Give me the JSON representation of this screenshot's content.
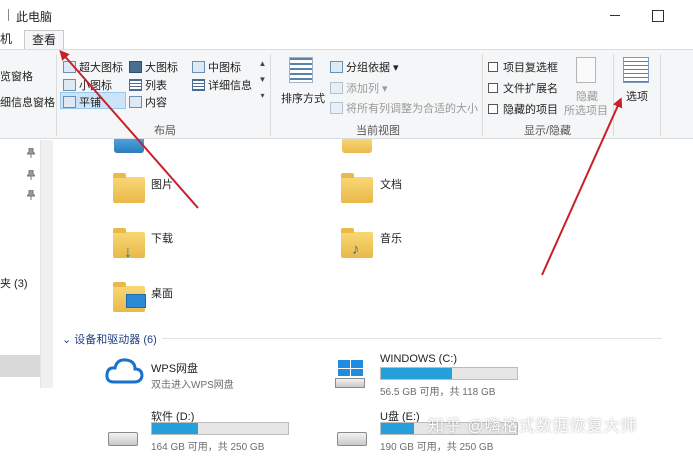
{
  "window": {
    "title": "此电脑"
  },
  "tabs": {
    "left_cut": "机",
    "view": "查看"
  },
  "ribbon": {
    "pane": {
      "preview": "览窗格",
      "details": "细信息窗格"
    },
    "layout": {
      "caption": "布局",
      "items": [
        "超大图标",
        "大图标",
        "中图标",
        "小图标",
        "列表",
        "详细信息",
        "平铺",
        "内容"
      ]
    },
    "current_view": {
      "caption": "当前视图",
      "sort": "排序方式",
      "group_by": "分组依据",
      "add_column": "添加列",
      "fit_columns": "将所有列调整为合适的大小"
    },
    "show_hide": {
      "caption": "显示/隐藏",
      "checkboxes": [
        "项目复选框",
        "文件扩展名",
        "隐藏的项目"
      ],
      "hide_label": "隐藏",
      "hide_sub": "所选项目"
    },
    "options": "选项"
  },
  "nav": {
    "quick_access_partial": "夹 (3)"
  },
  "folders": [
    "图片",
    "文档",
    "下载",
    "音乐",
    "桌面"
  ],
  "devices": {
    "section": "设备和驱动器 (6)",
    "wps": {
      "name": "WPS网盘",
      "sub": "双击进入WPS网盘"
    },
    "drives": [
      {
        "name": "WINDOWS (C:)",
        "space": "56.5 GB 可用，共 118 GB",
        "used_fraction": 0.52
      },
      {
        "name": "软件 (D:)",
        "space": "164 GB 可用，共 250 GB",
        "used_fraction": 0.34
      },
      {
        "name": "U盘 (E:)",
        "space": "190 GB 可用，共 250 GB",
        "used_fraction": 0.24
      }
    ]
  },
  "watermark": "知乎 @嗨格式数据恢复大师",
  "colors": {
    "accent": "#26a0da",
    "arrow": "#c8202a",
    "section": "#1e3f82"
  }
}
